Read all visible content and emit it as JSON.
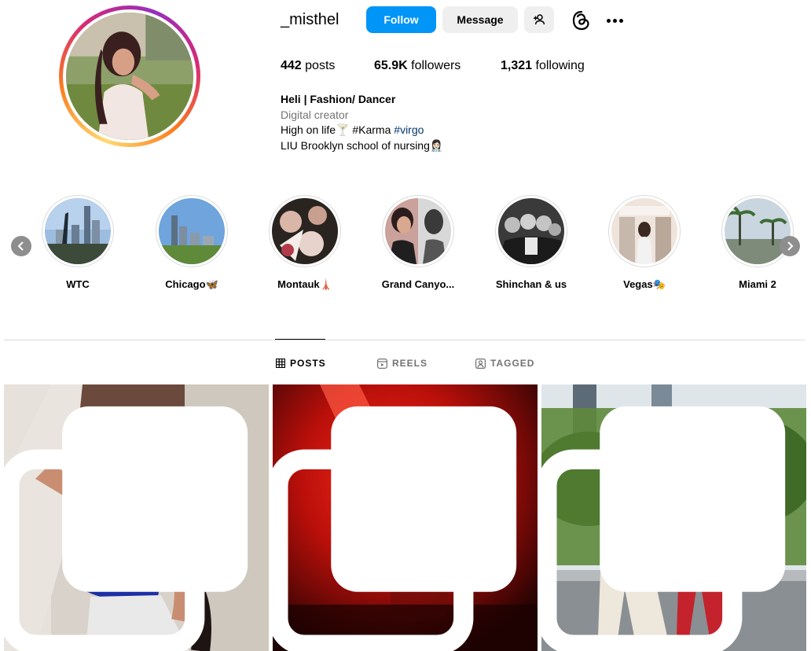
{
  "profile": {
    "username": "_misthel",
    "follow_label": "Follow",
    "message_label": "Message",
    "posts_count": "442",
    "posts_label": "posts",
    "followers_count": "65.9K",
    "followers_label": "followers",
    "following_count": "1,321",
    "following_label": "following",
    "full_name": "Heli | Fashion/ Dancer",
    "category": "Digital creator",
    "bio_line1_text": "High on life🍸 #Karma ",
    "bio_line1_hashtag": "#virgo",
    "bio_line2": "LIU Brooklyn school of nursing👩🏻‍⚕️"
  },
  "highlights": [
    {
      "label": "WTC"
    },
    {
      "label": "Chicago🦋"
    },
    {
      "label": "Montauk🗼"
    },
    {
      "label": "Grand Canyo..."
    },
    {
      "label": "Shinchan & us"
    },
    {
      "label": "Vegas🎭"
    },
    {
      "label": "Miami 2"
    }
  ],
  "tabs": {
    "posts": "POSTS",
    "reels": "REELS",
    "tagged": "TAGGED",
    "active": "posts"
  },
  "colors": {
    "follow_button": "#0095f6",
    "secondary_button": "#efefef",
    "hashtag": "#00376b",
    "muted_text": "#737373"
  }
}
